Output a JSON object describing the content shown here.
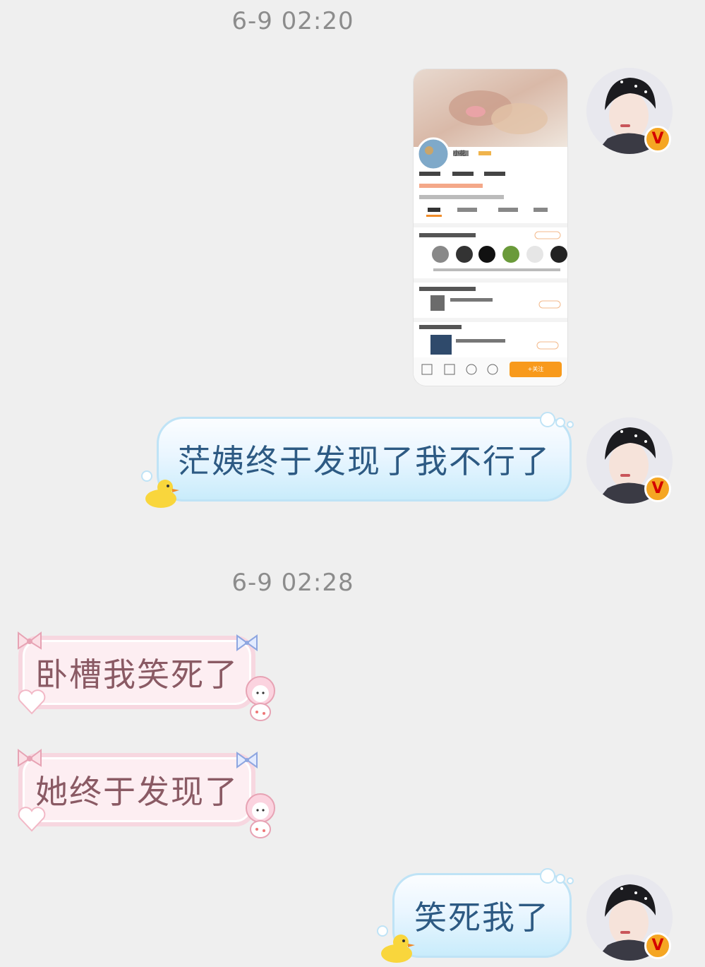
{
  "timestamps": [
    "6-9 02:20",
    "6-9 02:28"
  ],
  "messages": [
    {
      "side": "right",
      "type": "image",
      "image_content": {
        "name": "小花",
        "tabs": [
          "动态",
          "超话",
          "视频",
          "相册"
        ],
        "follow_button": "+关注"
      }
    },
    {
      "side": "right",
      "type": "text",
      "text": "茫姨终于发现了我不行了"
    },
    {
      "side": "left",
      "type": "text",
      "text": "卧槽我笑死了"
    },
    {
      "side": "left",
      "type": "text",
      "text": "她终于发现了"
    },
    {
      "side": "right",
      "type": "text",
      "text": "笑死我了"
    }
  ],
  "avatar_badge": "V",
  "colors": {
    "background": "#efefef",
    "timestamp": "#8c8c8c",
    "right_bubble_text": "#2d5a83",
    "left_bubble_text": "#8a5a64",
    "badge": "#f5a623"
  }
}
